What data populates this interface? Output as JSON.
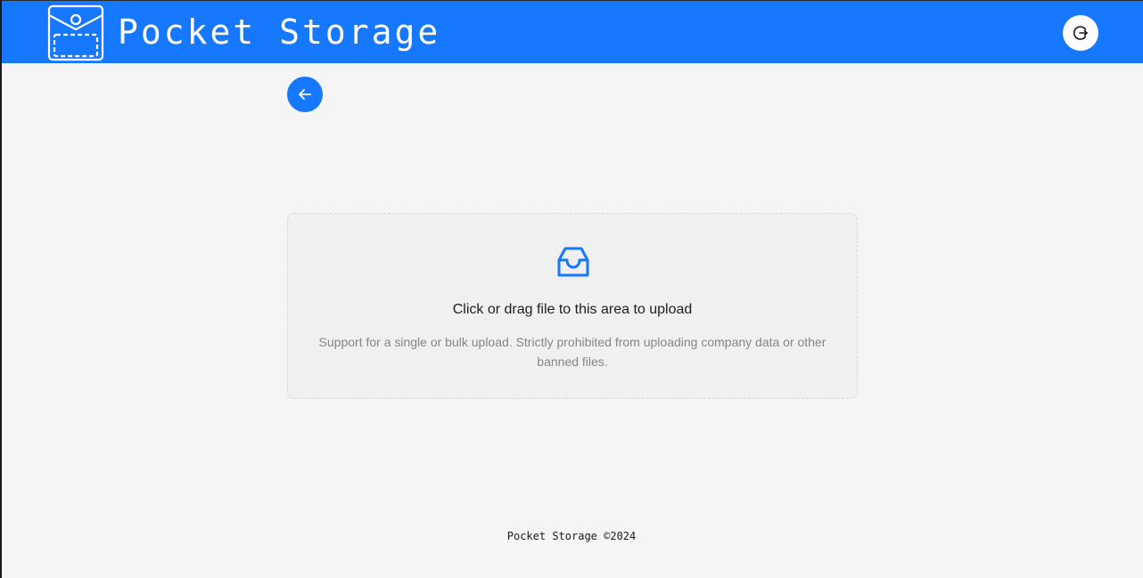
{
  "header": {
    "brand": "Pocket Storage",
    "logo_icon": "pocket-envelope-logo",
    "logout_icon": "logout-icon",
    "color": "#1677ff"
  },
  "nav": {
    "back_icon": "arrow-left-icon"
  },
  "upload": {
    "icon": "inbox-icon",
    "text": "Click or drag file to this area to upload",
    "hint": "Support for a single or bulk upload. Strictly prohibited from uploading company data or other banned files."
  },
  "footer": {
    "text": "Pocket Storage ©2024"
  }
}
